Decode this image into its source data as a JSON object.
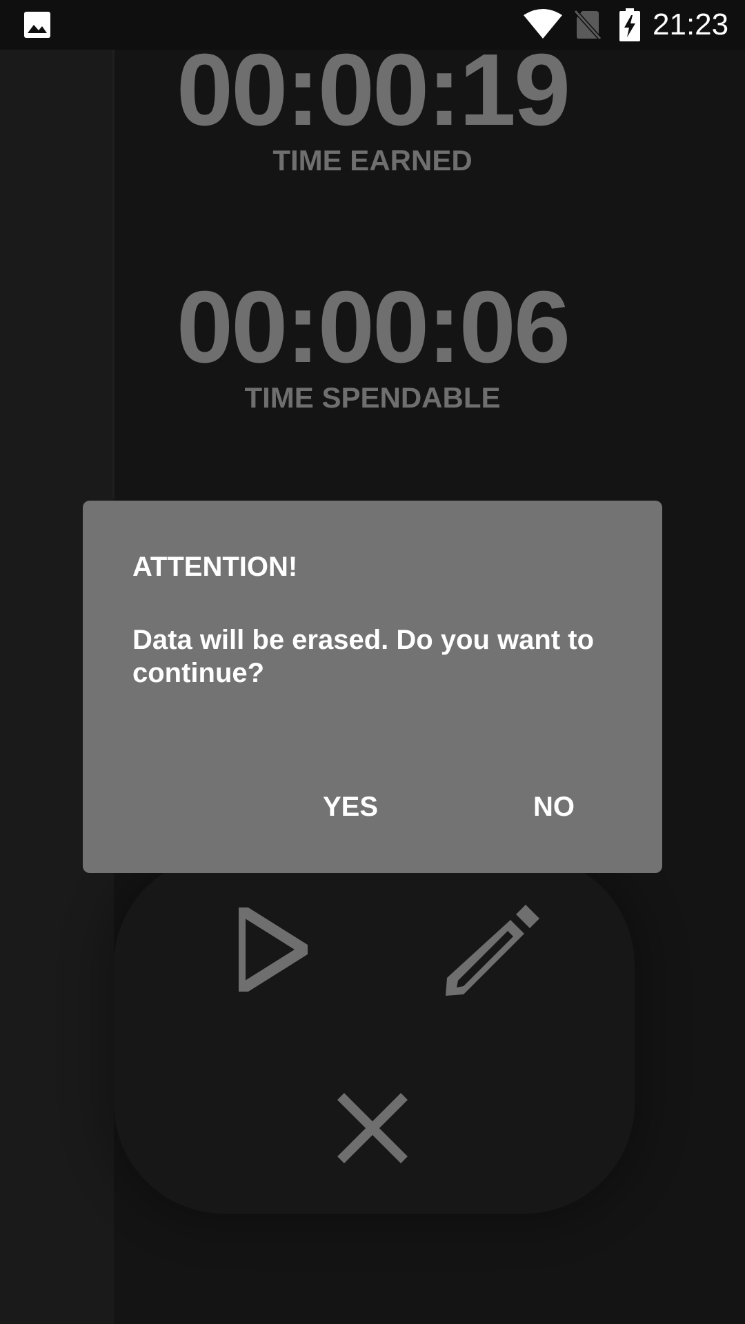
{
  "status_bar": {
    "time": "21:23",
    "icons": [
      "gallery-icon",
      "wifi-icon",
      "no-sim-icon",
      "battery-charging-icon"
    ]
  },
  "timers": {
    "earned": {
      "value": "00:00:19",
      "label": "TIME EARNED"
    },
    "spendable": {
      "value": "00:00:06",
      "label": "TIME SPENDABLE"
    }
  },
  "controls": {
    "icons": [
      "play-icon",
      "edit-icon",
      "close-icon"
    ]
  },
  "dialog": {
    "title": "ATTENTION!",
    "message": "Data will be erased. Do you want to continue?",
    "yes_label": "YES",
    "no_label": "NO"
  },
  "colors": {
    "background": "#141414",
    "timer_text": "#6f6f6f",
    "dialog_bg": "#737373",
    "dialog_text": "#ffffff",
    "icon": "#6f6f6f"
  }
}
